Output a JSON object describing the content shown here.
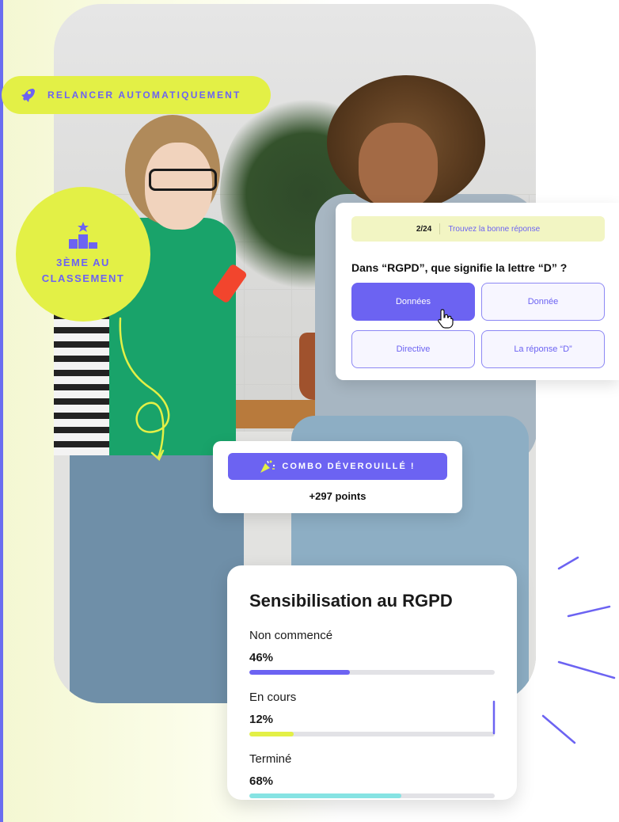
{
  "relaunch": {
    "label": "RELANCER AUTOMATIQUEMENT",
    "icon": "rocket-icon"
  },
  "rank": {
    "line1": "3ÈME AU",
    "line2": "CLASSEMENT",
    "icon": "podium-icon"
  },
  "quiz": {
    "progress": "2/24",
    "hint": "Trouvez la bonne réponse",
    "question": "Dans “RGPD”, que signifie la lettre “D” ?",
    "options": [
      {
        "label": "Données",
        "selected": true
      },
      {
        "label": "Donnée",
        "selected": false
      },
      {
        "label": "Directive",
        "selected": false
      },
      {
        "label": "La réponse “D”",
        "selected": false
      }
    ]
  },
  "combo": {
    "label": "COMBO DÉVEROUILLÉ !",
    "points": "+297 points",
    "icon": "party-popper-icon"
  },
  "stats": {
    "title": "Sensibilisation au RGPD",
    "rows": [
      {
        "label": "Non commencé",
        "percent": "46%",
        "fill": 0.41,
        "color": "#6c63f2"
      },
      {
        "label": "En cours",
        "percent": "12%",
        "fill": 0.18,
        "color": "#e3f046"
      },
      {
        "label": "Terminé",
        "percent": "68%",
        "fill": 0.62,
        "color": "#86e3e3"
      }
    ]
  },
  "colors": {
    "accent": "#6c63f2",
    "lime": "#e3f046",
    "teal": "#86e3e3"
  }
}
